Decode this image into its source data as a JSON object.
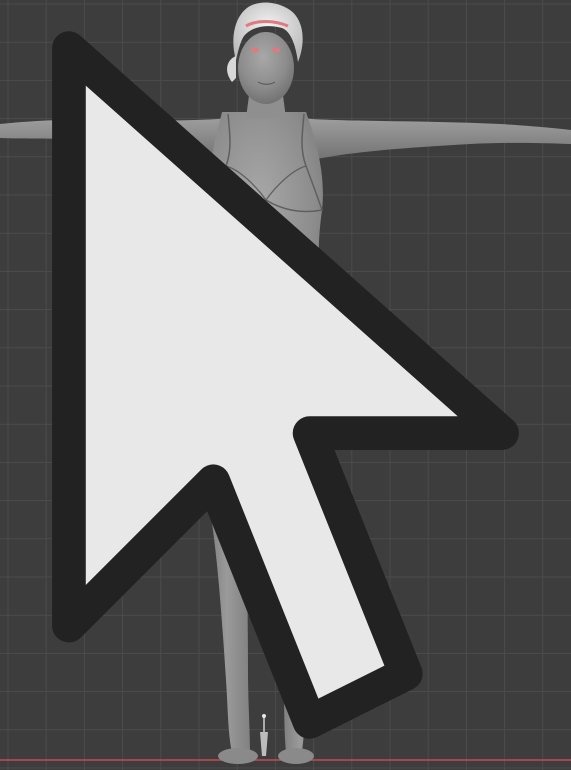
{
  "viewport": {
    "kind": "3d-viewport",
    "background_color": "#3d3d3d",
    "grid_line_color": "#4c4c4c",
    "floor_line_color": "#c94a55",
    "grid_visible": true
  },
  "model": {
    "name": "female-base-mesh",
    "pose": "t-pose",
    "view": "front",
    "shading": "solid-gray",
    "skin_color": "#8a8a8a",
    "hair_color": "#e6e6e6",
    "accent_color": "#e07a80"
  },
  "cursor": {
    "icon": "arrow-cursor-icon"
  }
}
